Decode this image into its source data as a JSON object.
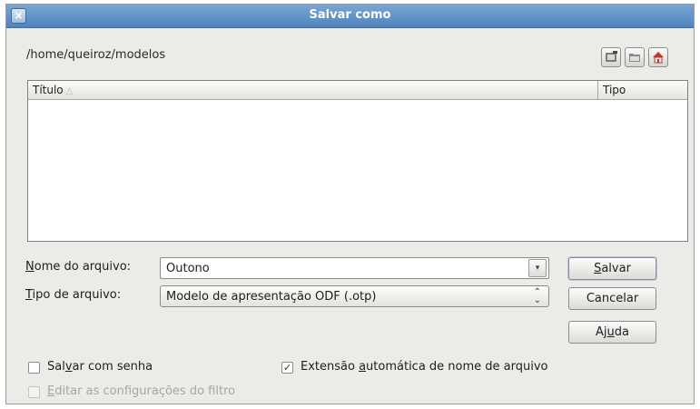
{
  "window": {
    "title": "Salvar como",
    "close_glyph": "×"
  },
  "path": "/home/queiroz/modelos",
  "toolbar": {
    "icons": [
      "new-folder-icon",
      "default-directory-icon",
      "home-icon"
    ]
  },
  "file_list": {
    "columns": [
      "Título",
      "Tipo"
    ],
    "sort_indicator": "△",
    "rows": []
  },
  "filename": {
    "label_mnemonic": "N",
    "label_rest": "ome do arquivo:",
    "value": "Outono",
    "dropdown_glyph": "▾"
  },
  "filetype": {
    "label_mnemonic": "T",
    "label_rest": "ipo de arquivo:",
    "selected": "Modelo de apresentação ODF (.otp)"
  },
  "buttons": {
    "save_mnemonic": "S",
    "save_rest": "alvar",
    "cancel": "Cancelar",
    "help_pre": "Aj",
    "help_mnemonic": "u",
    "help_post": "da"
  },
  "options": {
    "password_pre": "Sal",
    "password_mnemonic": "v",
    "password_post": "ar com senha",
    "password_checked": false,
    "autoext_pre": "Extensão ",
    "autoext_mnemonic": "a",
    "autoext_post": "utomática de nome de arquivo",
    "autoext_checked": true,
    "filter_mnemonic": "E",
    "filter_rest": "ditar as configurações do filtro",
    "filter_enabled": false
  },
  "colors": {
    "titlebar": "#4f83bd",
    "dialog_bg": "#ecebe8"
  }
}
